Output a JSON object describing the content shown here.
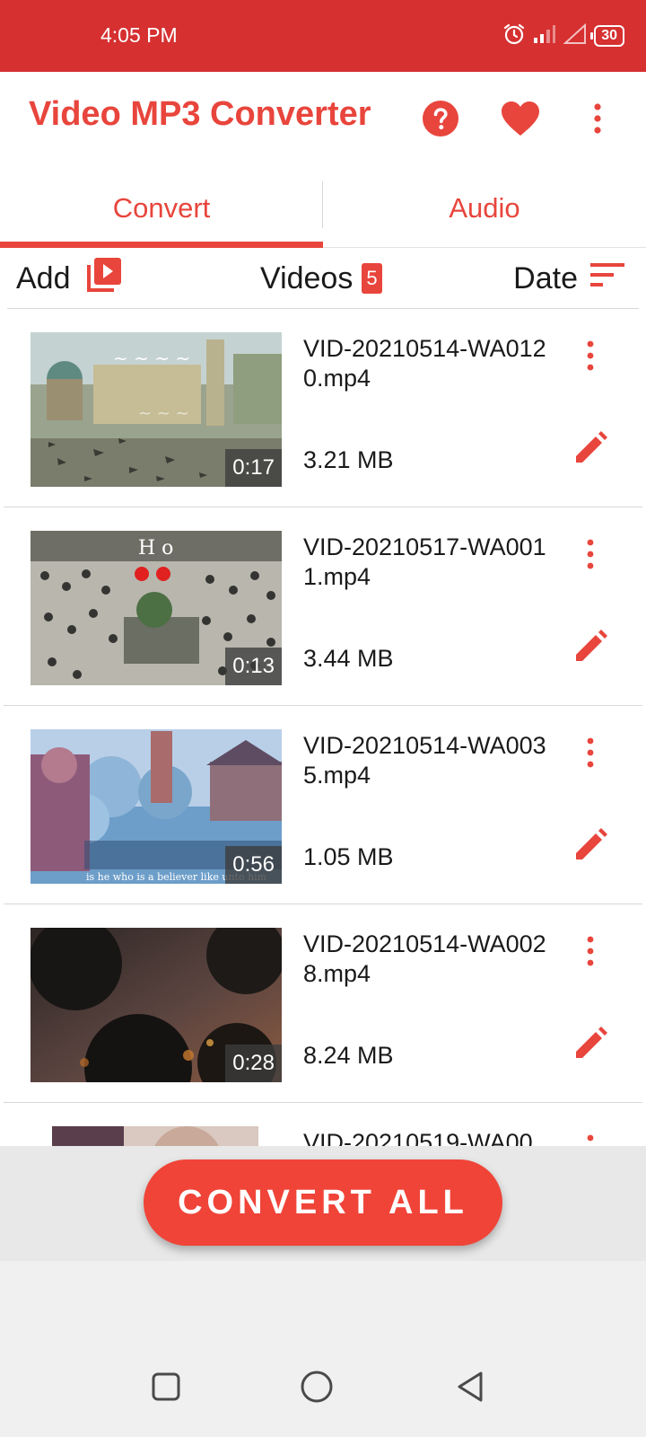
{
  "status_bar": {
    "time": "4:05 PM",
    "battery": "30",
    "icons": [
      "alarm-icon",
      "signal-icon",
      "signal-empty-icon",
      "battery-icon"
    ]
  },
  "app_bar": {
    "title": "Video MP3 Converter",
    "actions": [
      "help-icon",
      "heart-icon",
      "more-vert-icon"
    ]
  },
  "tabs": [
    {
      "label": "Convert",
      "selected": true
    },
    {
      "label": "Audio",
      "selected": false
    }
  ],
  "toolbar": {
    "add_label": "Add",
    "videos_label": "Videos",
    "videos_count": "5",
    "sort_label": "Date"
  },
  "videos": [
    {
      "name": "VID-20210514-WA0120.mp4",
      "size": "3.21 MB",
      "duration": "0:17",
      "thumbnail": "mosque-courtyard-birds"
    },
    {
      "name": "VID-20210517-WA0011.mp4",
      "size": "3.44 MB",
      "duration": "0:13",
      "thumbnail": "crowd-praying-aerial"
    },
    {
      "name": "VID-20210514-WA0035.mp4",
      "size": "1.05 MB",
      "duration": "0:56",
      "thumbnail": "illustrated-lake-scene"
    },
    {
      "name": "VID-20210514-WA0028.mp4",
      "size": "8.24 MB",
      "duration": "0:28",
      "thumbnail": "dark-trees-sunset"
    },
    {
      "name": "VID-20210519-WA00",
      "size": "",
      "duration": "",
      "thumbnail": "portrait-partial"
    }
  ],
  "convert_all_label": "CONVERT ALL",
  "colors": {
    "status_bar": "#d63031",
    "accent": "#e8453c",
    "button": "#f04438"
  },
  "nav": [
    "recent-apps-icon",
    "home-icon",
    "back-icon"
  ]
}
